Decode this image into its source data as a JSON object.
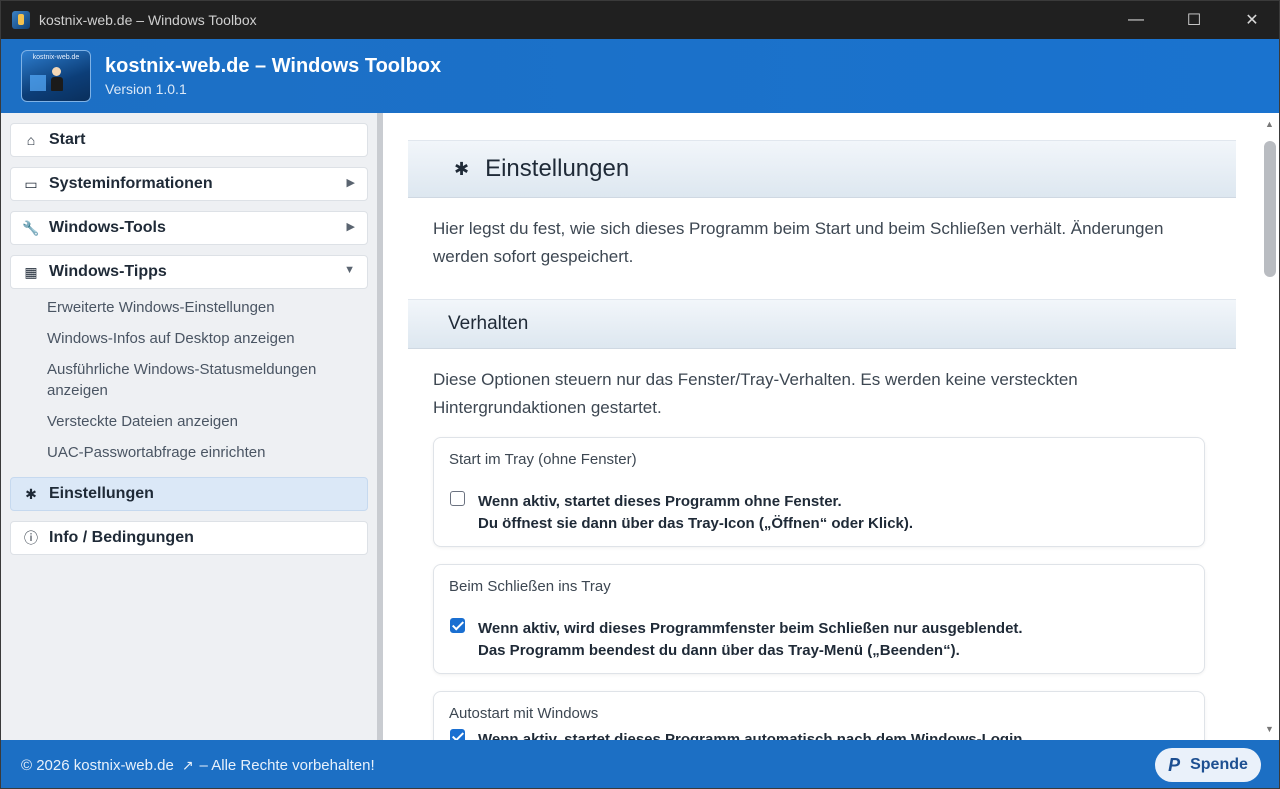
{
  "window": {
    "title": "kostnix-web.de – Windows Toolbox",
    "controls": {
      "minimize": "—",
      "maximize": "☐",
      "close": "✕"
    }
  },
  "header": {
    "logo_text": "kostnix-web.de",
    "app_name": "kostnix-web.de – Windows Toolbox",
    "version": "Version 1.0.1"
  },
  "sidebar": {
    "items": [
      {
        "label": "Start",
        "icon": "home-icon",
        "glyph": "⌂"
      },
      {
        "label": "Systeminformationen",
        "icon": "monitor-icon",
        "glyph": "▭",
        "arrow": "▶"
      },
      {
        "label": "Windows-Tools",
        "icon": "wrench-icon",
        "glyph": "🔧",
        "arrow": "▶"
      },
      {
        "label": "Windows-Tipps",
        "icon": "grid-icon",
        "glyph": "▦",
        "arrow": "▼"
      },
      {
        "label": "Einstellungen",
        "icon": "gear-icon",
        "glyph": "✱"
      },
      {
        "label": "Info / Bedingungen",
        "icon": "info-icon",
        "glyph": "ⓘ"
      }
    ],
    "subitems": [
      "Erweiterte Windows-Einstellungen",
      "Windows-Infos auf Desktop anzeigen",
      "Ausführliche Windows-Statusmeldungen anzeigen",
      "Versteckte Dateien anzeigen",
      "UAC-Passwortabfrage einrichten"
    ]
  },
  "main": {
    "title_icon": "✱",
    "title": "Einstellungen",
    "intro": "Hier legst du fest, wie sich dieses Programm beim Start und beim Schließen verhält. Änderungen werden sofort gespeichert.",
    "section_title": "Verhalten",
    "section_desc": "Diese Optionen steuern nur das Fenster/Tray-Verhalten. Es werden keine versteckten Hintergrundaktionen gestartet.",
    "cards": [
      {
        "title": "Start im Tray (ohne Fenster)",
        "checked": false,
        "line1": "Wenn aktiv, startet dieses Programm ohne Fenster.",
        "line2": "Du öffnest sie dann über das Tray-Icon („Öffnen“ oder Klick)."
      },
      {
        "title": "Beim Schließen ins Tray",
        "checked": true,
        "line1": "Wenn aktiv, wird dieses Programmfenster beim Schließen nur ausgeblendet.",
        "line2": "Das Programm beendest du dann über das Tray-Menü („Beenden“)."
      },
      {
        "title": "Autostart mit Windows",
        "checked": true,
        "line1": "Wenn aktiv, startet dieses Programm automatisch nach dem Windows-Login.",
        "line2": ""
      }
    ]
  },
  "footer": {
    "copyright": "© 2026 kostnix-web.de",
    "external_icon": "↗",
    "rights": "– Alle Rechte vorbehalten!",
    "donate_icon": "P",
    "donate_label": "Spende"
  },
  "colors": {
    "accent": "#1c6fc4",
    "active_nav": "#dbe8f7",
    "checkbox_on": "#1a6fd1"
  }
}
